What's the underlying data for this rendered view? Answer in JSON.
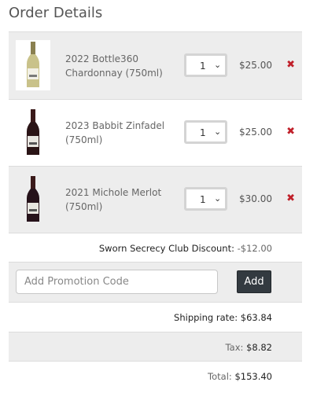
{
  "title": "Order Details",
  "items": [
    {
      "name": "2022 Bottle360 Chardonnay (750ml)",
      "qty": "1",
      "price": "$25.00",
      "remove": "✖"
    },
    {
      "name": "2023 Babbit Zinfadel (750ml)",
      "qty": "1",
      "price": "$25.00",
      "remove": "✖"
    },
    {
      "name": "2021 Michole Merlot (750ml)",
      "qty": "1",
      "price": "$30.00",
      "remove": "✖"
    }
  ],
  "discount": {
    "label": "Sworn Secrecy Club Discount:",
    "value": "-$12.00"
  },
  "promo": {
    "placeholder": "Add Promotion Code",
    "button": "Add"
  },
  "shipping": {
    "label": "Shipping rate:",
    "value": "$63.84"
  },
  "tax": {
    "label": "Tax:",
    "value": "$8.82"
  },
  "total": {
    "label": "Total:",
    "value": "$153.40"
  },
  "colors": {
    "remove": "#c0202a",
    "button": "#333a40",
    "row_alt": "#ededed"
  }
}
